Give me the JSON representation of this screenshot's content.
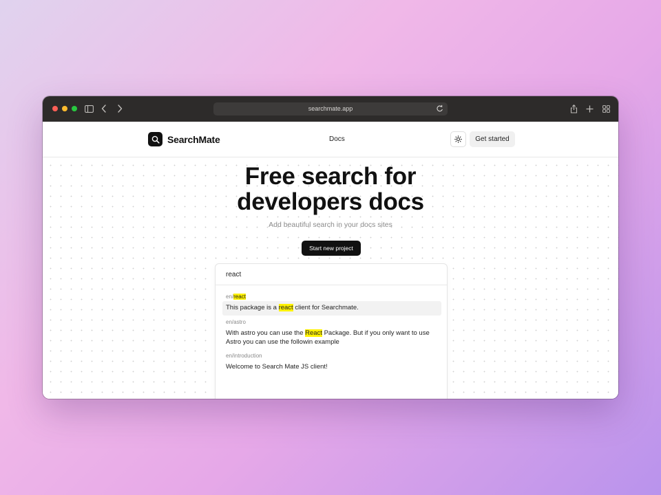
{
  "browser": {
    "url": "searchmate.app"
  },
  "navbar": {
    "logo_text": "SearchMate",
    "docs_link": "Docs",
    "cta_label": "Get started"
  },
  "hero": {
    "title_line1": "Free search for",
    "title_line2": "developers docs",
    "subtitle": "Add beautiful search in your docs sites",
    "button_label": "Start new project"
  },
  "search": {
    "query": "react",
    "results": [
      {
        "path_prefix": "en/",
        "path_highlight": "react",
        "text_before": "This package is a ",
        "text_highlight": "react",
        "text_after": " client for Searchmate.",
        "active": true
      },
      {
        "path": "en/astro",
        "text_before": "With astro you can use the ",
        "text_highlight": "React",
        "text_after": " Package. But if you only want to use Astro you can use the followin example"
      },
      {
        "path": "en/introduction",
        "text": "Welcome to Search Mate JS client!"
      }
    ]
  }
}
